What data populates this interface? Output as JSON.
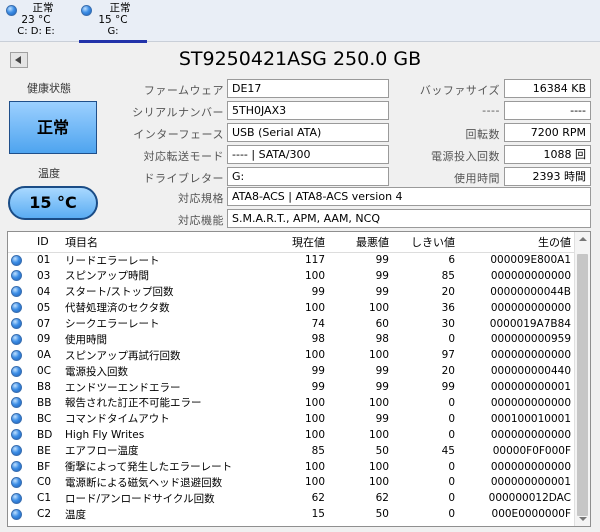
{
  "drives": [
    {
      "status": "正常",
      "temp": "23 °C",
      "letters": "C: D: E:",
      "active": false
    },
    {
      "status": "正常",
      "temp": "15 °C",
      "letters": "G:",
      "active": true
    }
  ],
  "disk": {
    "title": "ST9250421ASG 250.0 GB",
    "health_label": "健康状態",
    "health_value": "正常",
    "temp_label": "温度",
    "temp_value": "15 °C",
    "firmware_label": "ファームウェア",
    "firmware": "DE17",
    "serial_label": "シリアルナンバー",
    "serial": "5TH0JAX3",
    "interface_label": "インターフェース",
    "interface": "USB (Serial ATA)",
    "transfer_label": "対応転送モード",
    "transfer": "---- | SATA/300",
    "driveletter_label": "ドライブレター",
    "driveletter": "G:",
    "standard_label": "対応規格",
    "standard": "ATA8-ACS | ATA8-ACS version 4",
    "features_label": "対応機能",
    "features": "S.M.A.R.T., APM, AAM, NCQ",
    "buffer_label": "バッファサイズ",
    "buffer": "16384 KB",
    "blank1_label": "----",
    "blank1": "----",
    "rotation_label": "回転数",
    "rotation": "7200 RPM",
    "powercount_label": "電源投入回数",
    "powercount": "1088 回",
    "hours_label": "使用時間",
    "hours": "2393 時間"
  },
  "smart": {
    "headers": {
      "id": "ID",
      "name": "項目名",
      "current": "現在値",
      "worst": "最悪値",
      "threshold": "しきい値",
      "raw": "生の値"
    },
    "rows": [
      {
        "id": "01",
        "name": "リードエラーレート",
        "current": "117",
        "worst": "99",
        "threshold": "6",
        "raw": "000009E800A1"
      },
      {
        "id": "03",
        "name": "スピンアップ時間",
        "current": "100",
        "worst": "99",
        "threshold": "85",
        "raw": "000000000000"
      },
      {
        "id": "04",
        "name": "スタート/ストップ回数",
        "current": "99",
        "worst": "99",
        "threshold": "20",
        "raw": "00000000044B"
      },
      {
        "id": "05",
        "name": "代替処理済のセクタ数",
        "current": "100",
        "worst": "100",
        "threshold": "36",
        "raw": "000000000000"
      },
      {
        "id": "07",
        "name": "シークエラーレート",
        "current": "74",
        "worst": "60",
        "threshold": "30",
        "raw": "0000019A7B84"
      },
      {
        "id": "09",
        "name": "使用時間",
        "current": "98",
        "worst": "98",
        "threshold": "0",
        "raw": "000000000959"
      },
      {
        "id": "0A",
        "name": "スピンアップ再試行回数",
        "current": "100",
        "worst": "100",
        "threshold": "97",
        "raw": "000000000000"
      },
      {
        "id": "0C",
        "name": "電源投入回数",
        "current": "99",
        "worst": "99",
        "threshold": "20",
        "raw": "000000000440"
      },
      {
        "id": "B8",
        "name": "エンドツーエンドエラー",
        "current": "99",
        "worst": "99",
        "threshold": "99",
        "raw": "000000000001"
      },
      {
        "id": "BB",
        "name": "報告された訂正不可能エラー",
        "current": "100",
        "worst": "100",
        "threshold": "0",
        "raw": "000000000000"
      },
      {
        "id": "BC",
        "name": "コマンドタイムアウト",
        "current": "100",
        "worst": "99",
        "threshold": "0",
        "raw": "000100010001"
      },
      {
        "id": "BD",
        "name": "High Fly Writes",
        "current": "100",
        "worst": "100",
        "threshold": "0",
        "raw": "000000000000"
      },
      {
        "id": "BE",
        "name": "エアフロー温度",
        "current": "85",
        "worst": "50",
        "threshold": "45",
        "raw": "00000F0F000F"
      },
      {
        "id": "BF",
        "name": "衝撃によって発生したエラーレート",
        "current": "100",
        "worst": "100",
        "threshold": "0",
        "raw": "000000000000"
      },
      {
        "id": "C0",
        "name": "電源断による磁気ヘッド退避回数",
        "current": "100",
        "worst": "100",
        "threshold": "0",
        "raw": "000000000001"
      },
      {
        "id": "C1",
        "name": "ロード/アンロードサイクル回数",
        "current": "62",
        "worst": "62",
        "threshold": "0",
        "raw": "000000012DAC"
      },
      {
        "id": "C2",
        "name": "温度",
        "current": "15",
        "worst": "50",
        "threshold": "0",
        "raw": "000E0000000F"
      }
    ]
  }
}
